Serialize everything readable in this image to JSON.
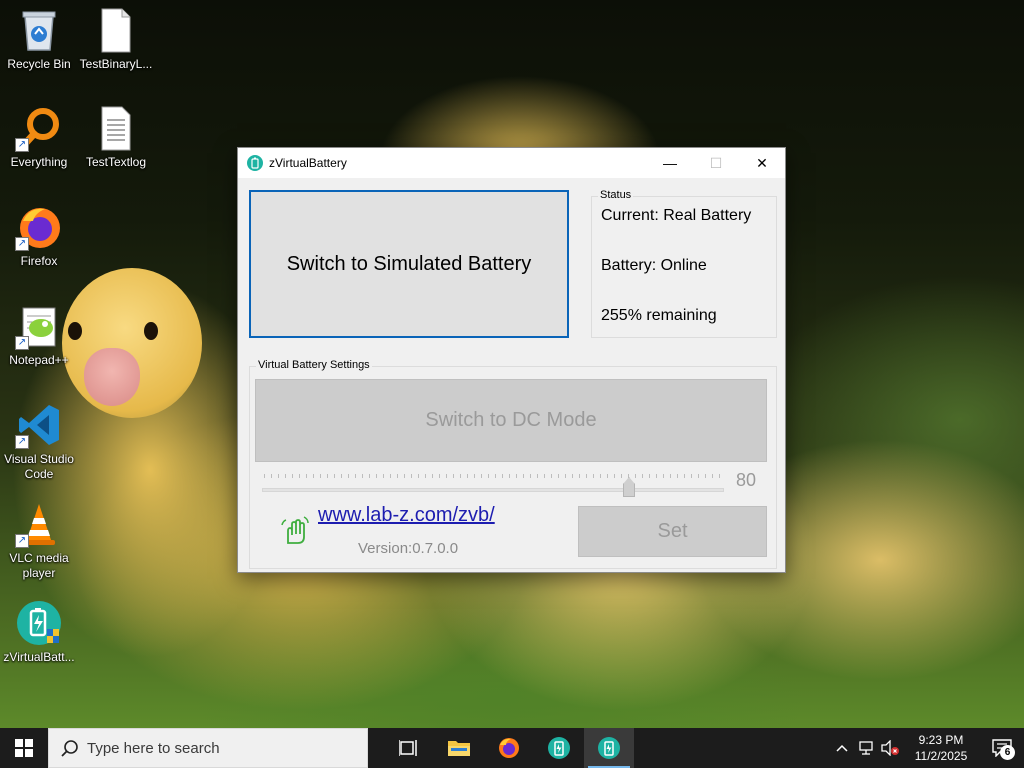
{
  "desktop": {
    "icons": [
      {
        "label": "Recycle Bin",
        "icon": "recycle-bin-icon"
      },
      {
        "label": "TestBinaryL...",
        "icon": "file-icon"
      },
      {
        "label": "Everything",
        "icon": "everything-search-icon"
      },
      {
        "label": "TestTextlog",
        "icon": "text-file-icon"
      },
      {
        "label": "Firefox",
        "icon": "firefox-icon"
      },
      {
        "label": "Notepad++",
        "icon": "notepadpp-icon"
      },
      {
        "label": "Visual Studio Code",
        "icon": "vscode-icon"
      },
      {
        "label": "VLC media player",
        "icon": "vlc-icon"
      },
      {
        "label": "zVirtualBatt...",
        "icon": "zvirtualbattery-icon"
      }
    ]
  },
  "window": {
    "title": "zVirtualBattery",
    "minimize": "—",
    "maximize": "☐",
    "close": "✕",
    "switch_button": "Switch to Simulated Battery",
    "status": {
      "label": "Status",
      "current": "Current: Real Battery",
      "battery": "Battery: Online",
      "remaining": "255% remaining"
    },
    "settings": {
      "label": "Virtual Battery Settings",
      "dc_button": "Switch to DC Mode",
      "slider_value": "80",
      "link": "www.lab-z.com/zvb/",
      "version": "Version:0.7.0.0",
      "set_button": "Set"
    }
  },
  "taskbar": {
    "search_placeholder": "Type here to search",
    "time": "9:23 PM",
    "date": "11/2/2025",
    "notification_count": "6",
    "accent": "#76b9ed"
  }
}
